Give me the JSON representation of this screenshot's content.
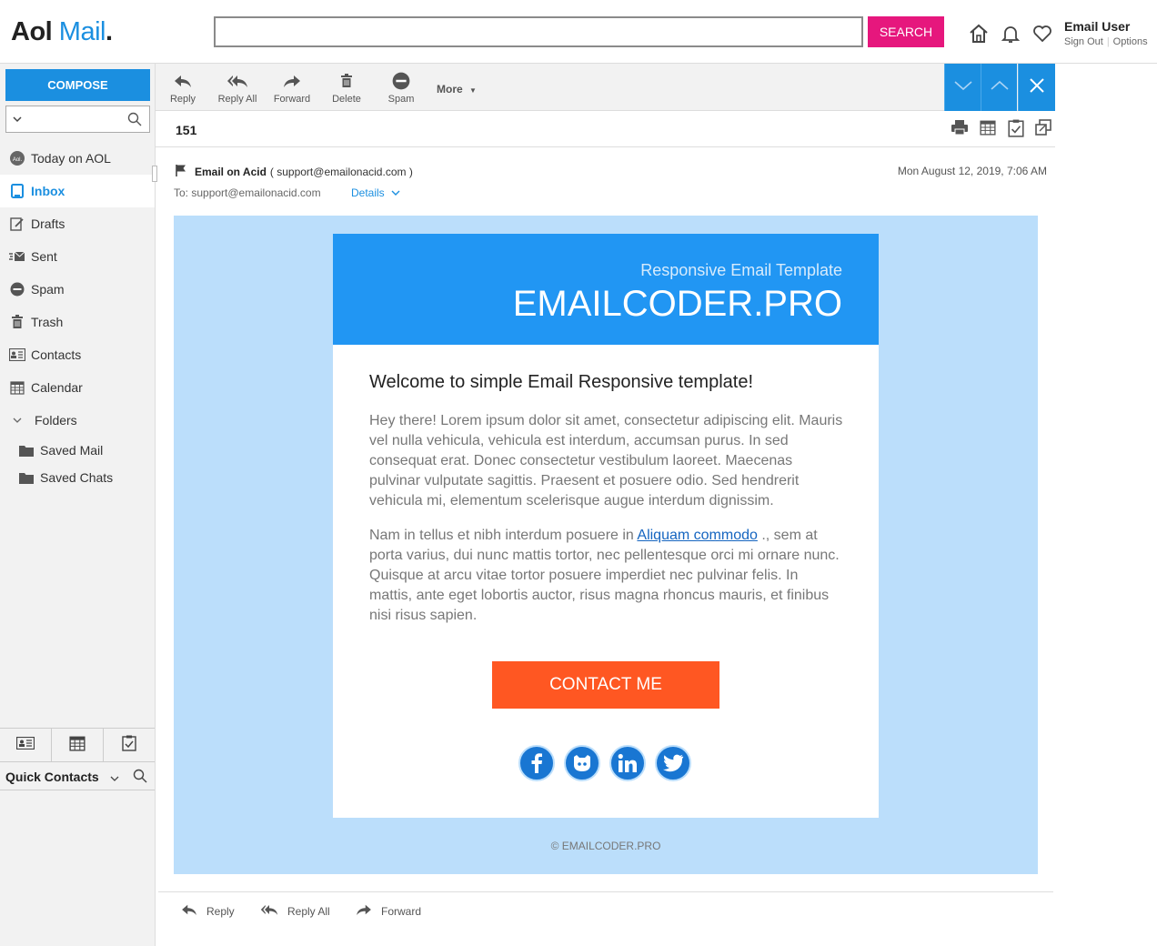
{
  "header": {
    "logo_aol": "Aol",
    "logo_mail": "Mail",
    "logo_dot": ".",
    "search_placeholder": "",
    "search_button": "SEARCH",
    "user_name": "Email User",
    "sign_out": "Sign Out",
    "options": "Options"
  },
  "sidebar": {
    "compose": "COMPOSE",
    "items": [
      {
        "label": "Today on AOL",
        "icon": "aol-icon"
      },
      {
        "label": "Inbox",
        "icon": "inbox-icon",
        "active": true
      },
      {
        "label": "Drafts",
        "icon": "drafts-icon"
      },
      {
        "label": "Sent",
        "icon": "sent-icon"
      },
      {
        "label": "Spam",
        "icon": "spam-icon"
      },
      {
        "label": "Trash",
        "icon": "trash-icon"
      },
      {
        "label": "Contacts",
        "icon": "contacts-icon"
      },
      {
        "label": "Calendar",
        "icon": "calendar-icon"
      },
      {
        "label": "Folders",
        "icon": "chevron-down-icon"
      },
      {
        "label": "Saved Mail",
        "icon": "folder-icon"
      },
      {
        "label": "Saved Chats",
        "icon": "folder-icon"
      }
    ],
    "quick_contacts": "Quick Contacts"
  },
  "toolbar": {
    "reply": "Reply",
    "reply_all": "Reply All",
    "forward": "Forward",
    "delete": "Delete",
    "spam": "Spam",
    "more": "More"
  },
  "message": {
    "subject": "151",
    "from_name": "Email on Acid",
    "from_email": "( support@emailonacid.com )",
    "date": "Mon August 12, 2019, 7:06 AM",
    "to": "To:  support@emailonacid.com",
    "details": "Details"
  },
  "email": {
    "hero_sub": "Responsive Email Template",
    "hero_title": "EMAILCODER.PRO",
    "heading": "Welcome to simple Email Responsive template!",
    "para1": "Hey there! Lorem ipsum dolor sit amet, consectetur adipiscing elit. Mauris vel nulla vehicula, vehicula est interdum, accumsan purus. In sed consequat erat. Donec consectetur vestibulum laoreet. Maecenas pulvinar vulputate sagittis. Praesent et posuere odio. Sed hendrerit vehicula mi, elementum scelerisque augue interdum dignissim.",
    "para2_before": "Nam in tellus et nibh interdum posuere in ",
    "para2_link": "Aliquam commodo",
    "para2_after": " ., sem at porta varius, dui nunc mattis tortor, nec pellentesque orci mi ornare nunc. Quisque at arcu vitae tortor posuere imperdiet nec pulvinar felis. In mattis, ante eget lobortis auctor, risus magna rhoncus mauris, et finibus nisi risus sapien.",
    "cta": "CONTACT ME",
    "socials": [
      "facebook-icon",
      "github-icon",
      "linkedin-icon",
      "twitter-icon"
    ],
    "copyright": "© EMAILCODER.PRO"
  },
  "bottom": {
    "reply": "Reply",
    "reply_all": "Reply All",
    "forward": "Forward"
  },
  "colors": {
    "brand_blue": "#1b8fe0",
    "search_pink": "#e6177d",
    "hero_blue": "#2196f3",
    "cta_orange": "#ff5722",
    "email_bg": "#bbdefb"
  }
}
